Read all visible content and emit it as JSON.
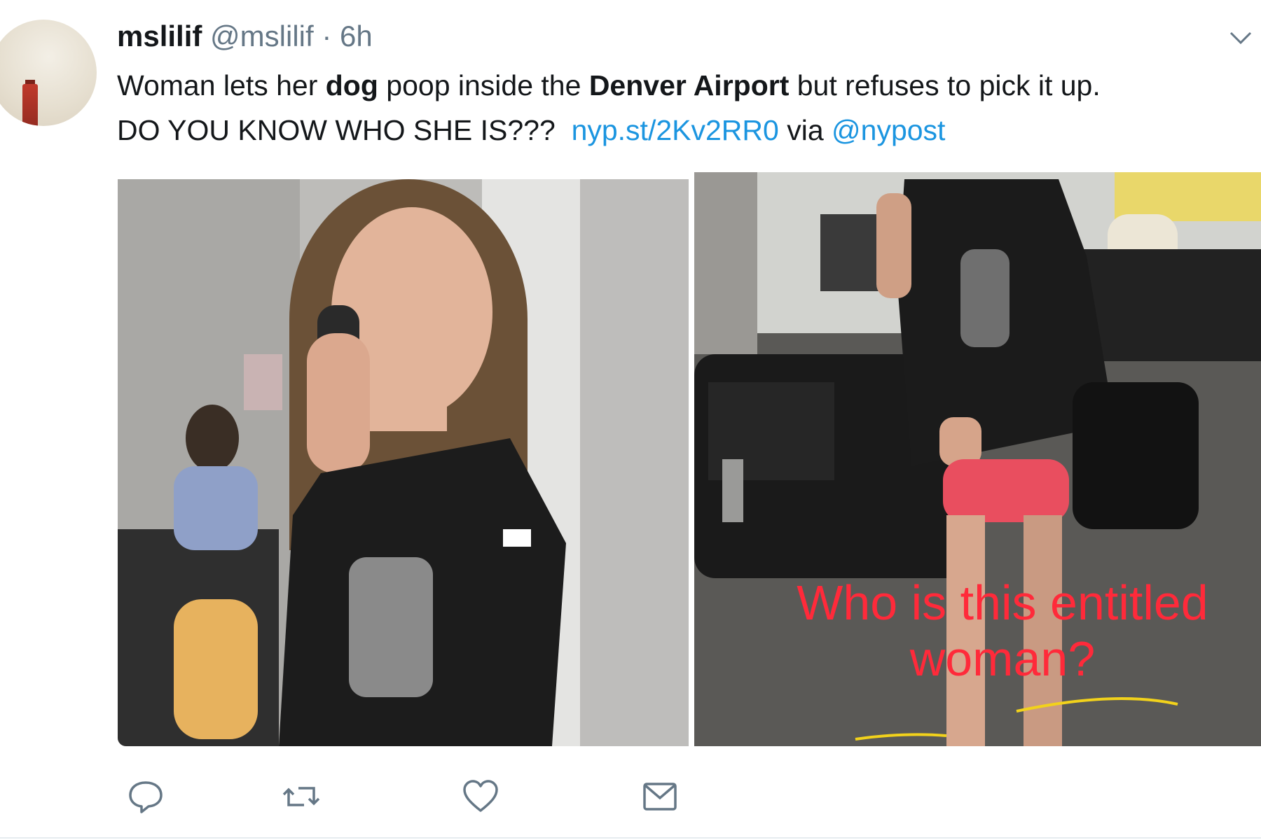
{
  "tweet": {
    "author_name": "mslilif",
    "author_handle": "@mslilif",
    "separator": "·",
    "timestamp": "6h",
    "text": {
      "part1": "Woman lets her ",
      "bold1": "dog",
      "part2": " poop inside the ",
      "bold2": "Denver Airport",
      "part3": " but refuses to pick it up.",
      "line2": "DO YOU KNOW WHO SHE IS???",
      "link": "nyp.st/2Kv2RR0",
      "via": " via ",
      "mention": "@nypost"
    },
    "media": {
      "caption_line1": "Who is this entitled",
      "caption_line2": "woman?"
    },
    "actions": [
      {
        "name": "reply",
        "icon": "reply-icon"
      },
      {
        "name": "retweet",
        "icon": "retweet-icon"
      },
      {
        "name": "like",
        "icon": "heart-icon"
      },
      {
        "name": "direct-message",
        "icon": "mail-icon"
      }
    ]
  },
  "colors": {
    "link": "#1b95e0",
    "secondary_text": "#657786",
    "caption_red": "#ff2a3a",
    "highlight_yellow": "#f2d21b"
  }
}
